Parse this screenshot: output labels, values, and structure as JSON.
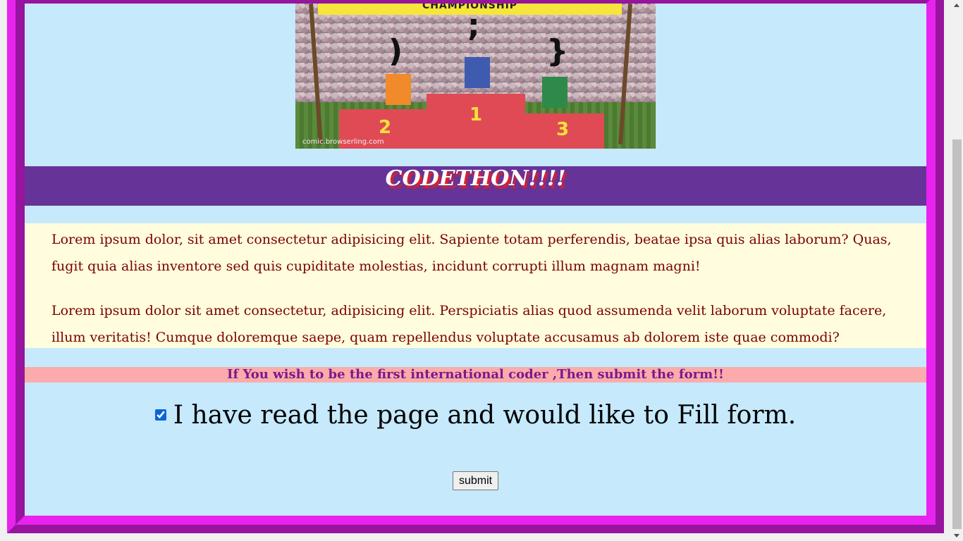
{
  "comic": {
    "banner_text": "CHAMPIONSHIP",
    "watermark": "comic.browserling.com",
    "podiums": [
      "1",
      "2",
      "3"
    ],
    "symbols": [
      ";",
      ")",
      "}"
    ]
  },
  "heading": {
    "title": "CODETHON!!!!"
  },
  "content": {
    "paragraphs": [
      "Lorem ipsum dolor, sit amet consectetur adipisicing elit. Sapiente totam perferendis, beatae ipsa quis alias laborum? Quas, fugit quia alias inventore sed quis cupiditate molestias, incidunt corrupti illum magnam magni!",
      "Lorem ipsum dolor sit amet consectetur, adipisicing elit. Perspiciatis alias quod assumenda velit laborum voluptate facere, illum veritatis! Cumque doloremque saepe, quam repellendus voluptate accusamus ab dolorem iste quae commodi?"
    ]
  },
  "cta": {
    "text": "If You wish to be the first international coder ,Then submit the form!!"
  },
  "form": {
    "checkbox_label": "I have read the page and would like to Fill form.",
    "checkbox_checked": true,
    "submit_label": "submit"
  },
  "colors": {
    "page_bg": "#c6e9fc",
    "frame_light": "#e823ee",
    "frame_dark": "#96149e",
    "heading_bg": "#663399",
    "heading_shadow": "#e62020",
    "text_block_bg": "#fffddd",
    "text_color": "#7a0000",
    "cta_bg": "#fbabab",
    "cta_color": "#7a1a8a"
  }
}
